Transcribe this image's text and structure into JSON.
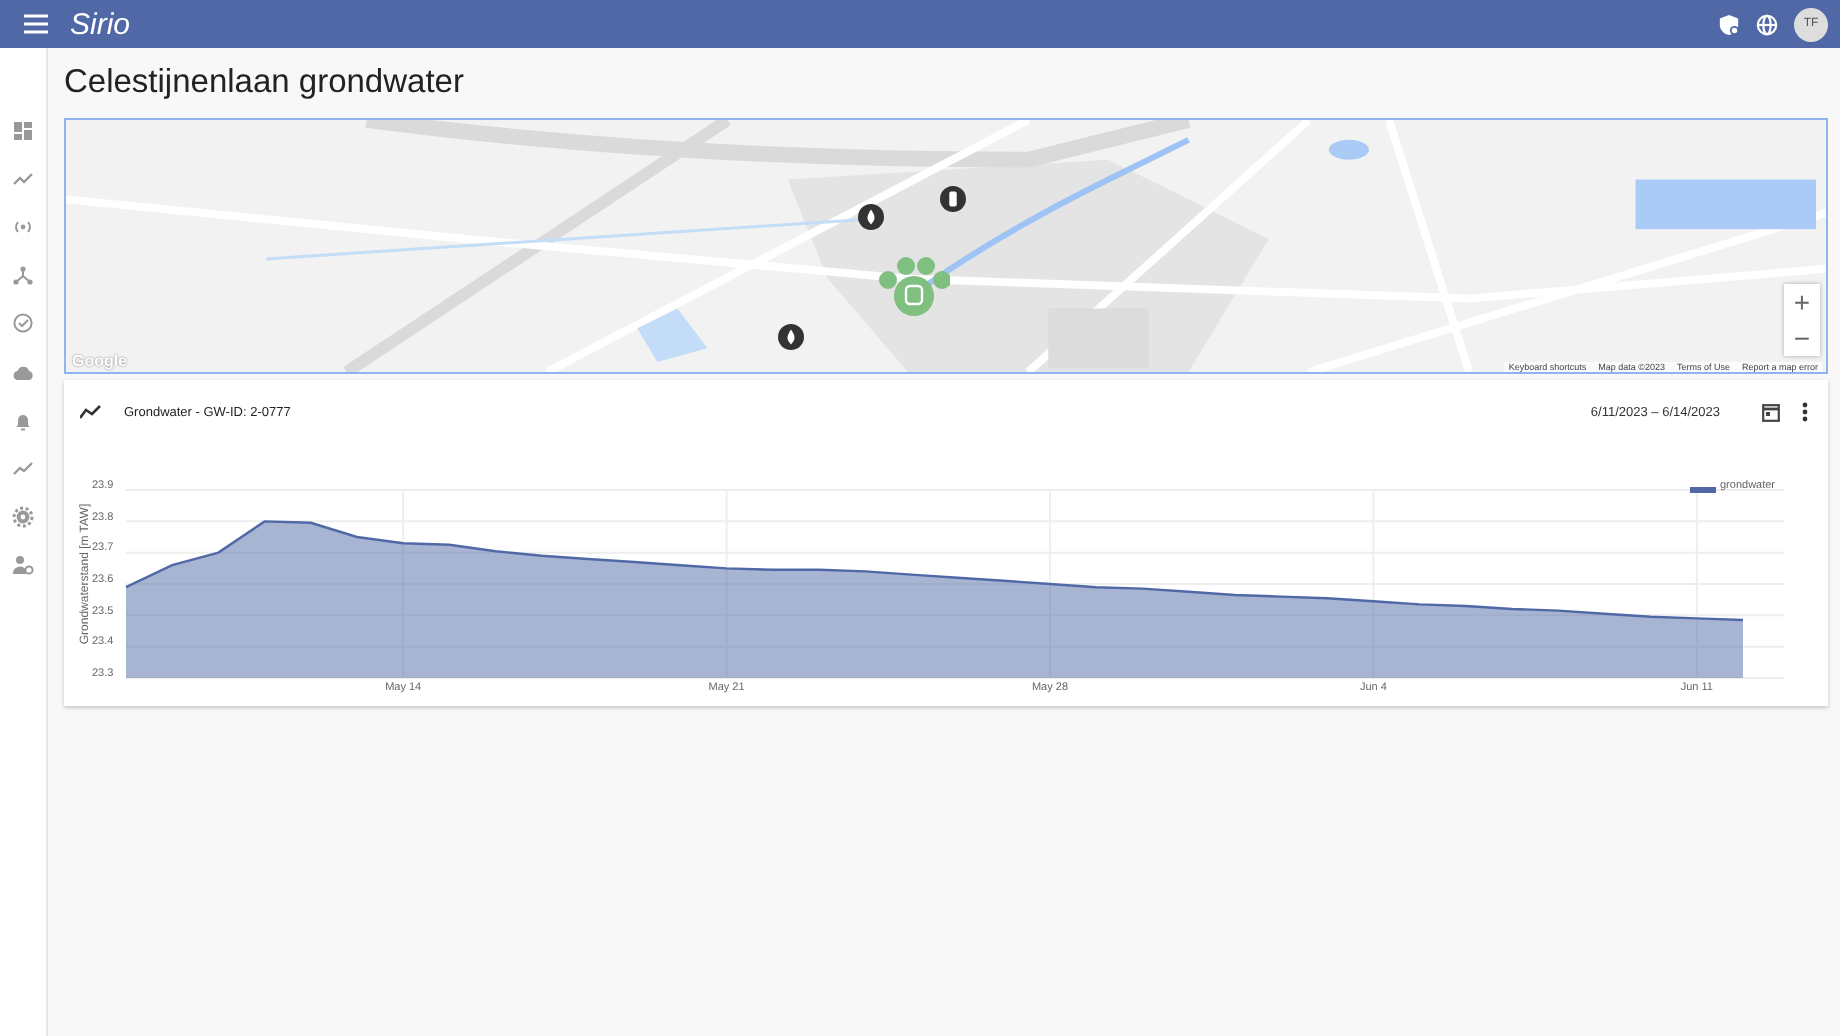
{
  "app_bar": {
    "logo": "Sirio",
    "avatar": "TF"
  },
  "page_title": "Celestijnenlaan grondwater",
  "map": {
    "zoom_in": "+",
    "zoom_out": "−",
    "logo": "Google",
    "attribution": [
      "Keyboard shortcuts",
      "Map data ©2023",
      "Terms of Use",
      "Report a map error"
    ]
  },
  "chart_card": {
    "title": "Grondwater - GW-ID: 2-0777",
    "date_range": "6/11/2023 – 6/14/2023",
    "chart_data": {
      "type": "area",
      "ylabel": "Grondwaterstand [m TAW]",
      "categories": [
        null,
        null,
        null,
        null,
        null,
        null,
        "May 14",
        null,
        null,
        null,
        null,
        null,
        null,
        "May 21",
        null,
        null,
        null,
        null,
        null,
        null,
        "May 28",
        null,
        null,
        null,
        null,
        null,
        null,
        "Jun 4",
        null,
        null,
        null,
        null,
        null,
        null,
        "Jun 11",
        null
      ],
      "ylim": [
        23.3,
        23.9
      ],
      "grid": true,
      "yticks": [
        23.3,
        23.4,
        23.5,
        23.6,
        23.7,
        23.8,
        23.9
      ],
      "series": [
        {
          "name": "grondwater",
          "color": "#5069a6",
          "values": [
            23.59,
            23.66,
            23.7,
            23.8,
            23.795,
            23.75,
            23.73,
            23.725,
            23.705,
            23.69,
            23.68,
            23.67,
            23.66,
            23.65,
            23.645,
            23.645,
            23.64,
            23.63,
            23.62,
            23.61,
            23.6,
            23.59,
            23.585,
            23.575,
            23.565,
            23.56,
            23.555,
            23.545,
            23.535,
            23.53,
            23.52,
            23.515,
            23.505,
            23.495,
            23.49,
            23.485
          ]
        }
      ]
    }
  }
}
